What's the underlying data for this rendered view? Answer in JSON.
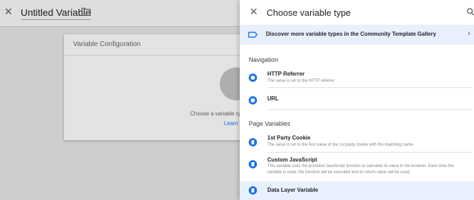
{
  "editor": {
    "title": "Untitled Variable",
    "card_title": "Variable Configuration",
    "choose_text": "Choose a variable ty",
    "learn_text": "Learn"
  },
  "panel": {
    "title": "Choose variable type",
    "discover_text": "Discover more variable types in the Community Template Gallery",
    "sections": [
      {
        "title": "Navigation"
      },
      {
        "title": "Page Variables"
      }
    ],
    "items": [
      {
        "title": "HTTP Referrer",
        "desc": "The value is set to the HTTP referrer."
      },
      {
        "title": "URL",
        "desc": ""
      },
      {
        "title": "1st Party Cookie",
        "desc": "The value is set to the first value of the 1st party cookie with the matching name."
      },
      {
        "title": "Custom JavaScript",
        "desc": "This variable uses the provided JavaScript function to calculate its value in the browser. Each time this variable is used, the function will be executed and its return value will be used."
      },
      {
        "title": "Data Layer Variable",
        "desc": ""
      }
    ]
  },
  "colors": {
    "accent": "#1a73e8",
    "highlight": "#e8f0fe"
  },
  "icons": [
    "close-icon",
    "folder-icon",
    "search-icon",
    "label-icon",
    "chevron-right-icon",
    "globe-icon",
    "document-icon"
  ]
}
